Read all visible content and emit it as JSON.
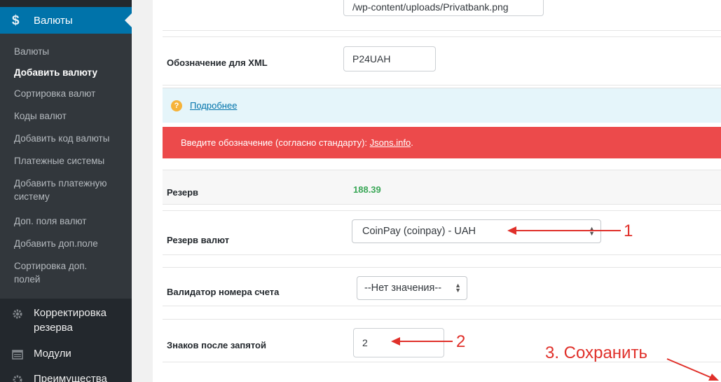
{
  "sidebar": {
    "current_menu": "Валюты",
    "submenu": [
      {
        "label": "Валюты",
        "active": false
      },
      {
        "label": "Добавить валюту",
        "active": true
      },
      {
        "label": "Сортировка валют",
        "active": false
      },
      {
        "label": "Коды валют",
        "active": false
      },
      {
        "label": "Добавить код валюты",
        "active": false
      },
      {
        "label": "Платежные системы",
        "active": false
      },
      {
        "label": "Добавить платежную системы_line1",
        "active": false
      }
    ],
    "submenu_labels": {
      "currencies": "Валюты",
      "add_currency": "Добавить валюту",
      "sort_currencies": "Сортировка валют",
      "currency_codes": "Коды валют",
      "add_currency_code": "Добавить код валюты",
      "payment_systems": "Платежные системы",
      "add_payment_system_1": "Добавить платежную",
      "add_payment_system_2": "систему",
      "extra_fields": "Доп. поля валют",
      "add_extra_field": "Добавить доп.поле",
      "sort_extra_fields_1": "Сортировка доп.",
      "sort_extra_fields_2": "полей"
    },
    "menu_items": {
      "reserve_adjust_1": "Корректировка",
      "reserve_adjust_2": "резерва",
      "modules": "Модули",
      "advantages": "Преимущества"
    }
  },
  "form": {
    "logo_path_value": "/wp-content/uploads/Privatbank.png",
    "xml_label": "Обозначение для XML",
    "xml_value": "P24UAH",
    "more_link": "Подробнее",
    "error_text": "Введите обозначение (согласно стандарту): ",
    "error_link": "Jsons.info",
    "error_suffix": ".",
    "reserve_label": "Резерв",
    "reserve_value": "188.39",
    "currency_reserve_label": "Резерв валют",
    "currency_reserve_value": "CoinPay (coinpay) - UAH",
    "validator_label": "Валидатор номера счета",
    "validator_value": "--Нет значения--",
    "decimals_label": "Знаков после запятой",
    "decimals_value": "2"
  },
  "annotations": {
    "step1": "1",
    "step2": "2",
    "step3": "3. Сохранить"
  },
  "colors": {
    "sidebar_bg": "#23282d",
    "submenu_bg": "#32373c",
    "active_menu": "#0073aa",
    "error_bg": "#ec4a4b",
    "info_bg": "#e5f5fa",
    "reserve_green": "#3aa757",
    "annotation_red": "#e0302a"
  }
}
